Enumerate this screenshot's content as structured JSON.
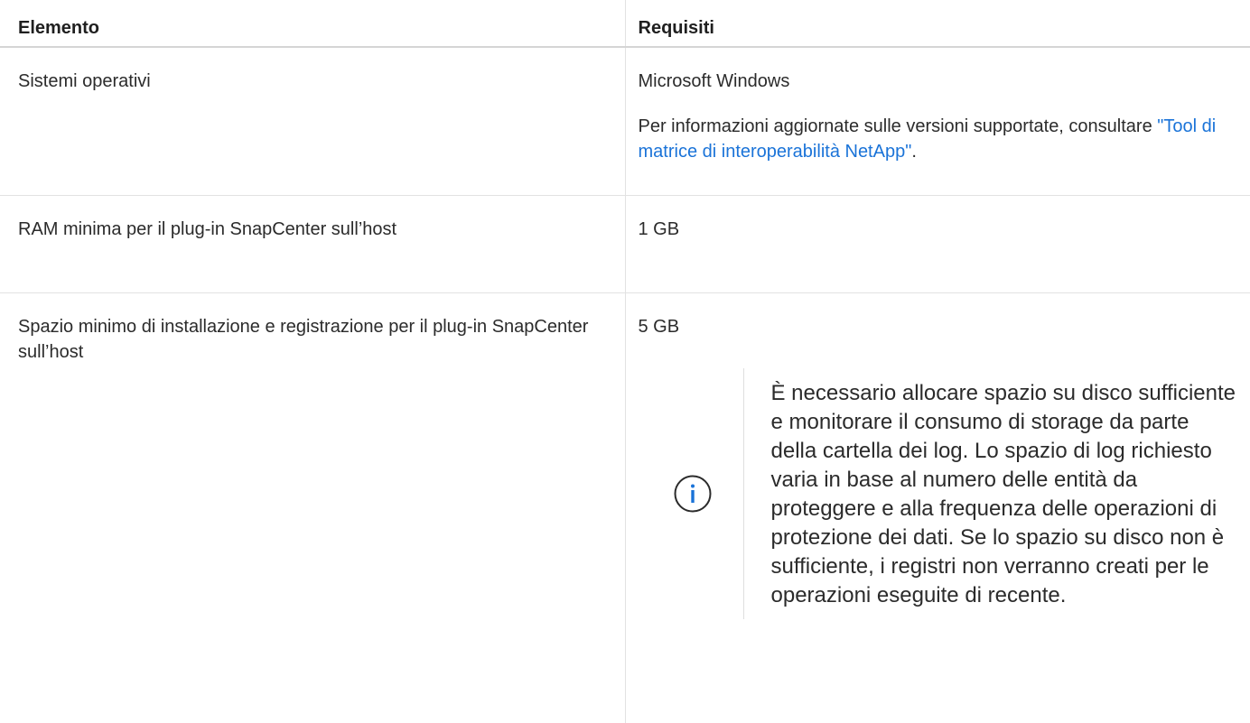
{
  "table": {
    "headers": [
      "Elemento",
      "Requisiti"
    ],
    "rows": [
      {
        "item": "Sistemi operativi",
        "requirement": "Microsoft Windows",
        "detail_prefix": "Per informazioni aggiornate sulle versioni supportate, consultare ",
        "detail_link": "\"Tool di matrice di interoperabilità NetApp\"",
        "detail_suffix": "."
      },
      {
        "item": "RAM minima per il plug-in SnapCenter sull’host",
        "requirement": "1 GB"
      },
      {
        "item": "Spazio minimo di installazione e registrazione per il plug-in SnapCenter sull’host",
        "requirement": "5 GB",
        "note_icon": "info-circle-icon",
        "note": "È necessario allocare spazio su disco sufficiente e monitorare il consumo di storage da parte della cartella dei log. Lo spazio di log richiesto varia in base al numero delle entità da proteggere e alla frequenza delle operazioni di protezione dei dati. Se lo spazio su disco non è sufficiente, i registri non verranno creati per le operazioni eseguite di recente."
      }
    ]
  },
  "colors": {
    "link": "#1a73d8",
    "border": "#e2e2e2",
    "icon": "#1a73d8"
  }
}
